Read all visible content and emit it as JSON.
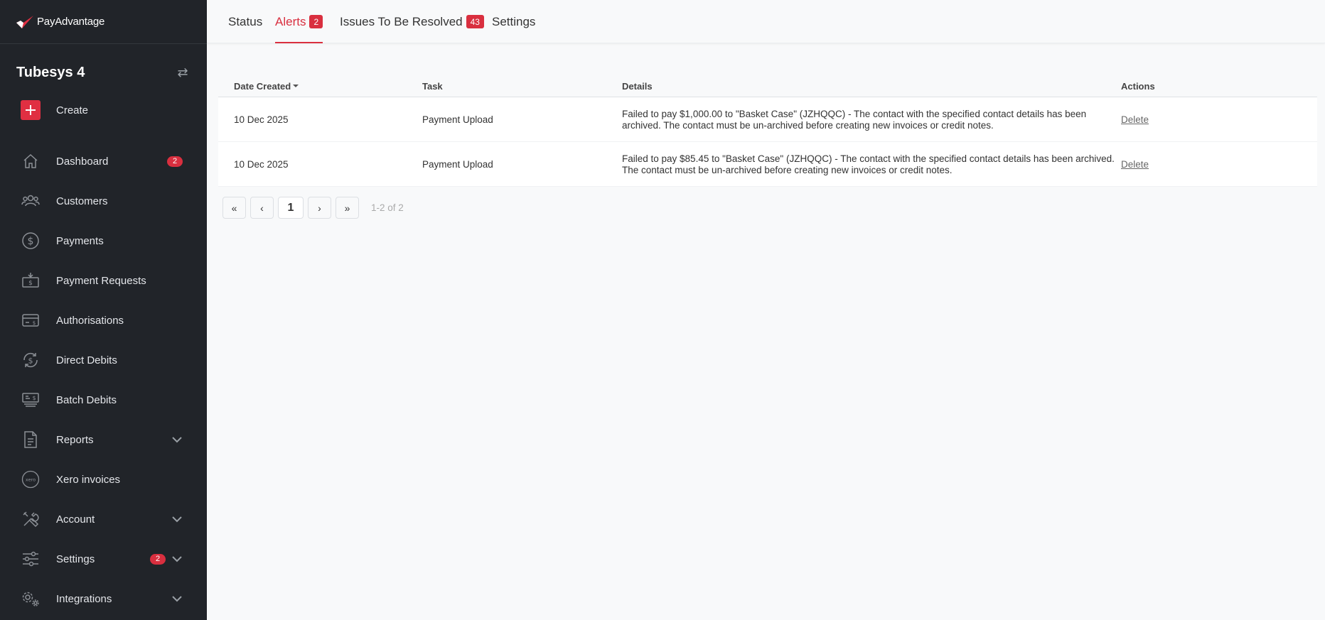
{
  "brand": {
    "name": "PayAdvantage"
  },
  "account": {
    "name": "Tubesys 4"
  },
  "sidebar": {
    "items": [
      {
        "label": "Create",
        "icon": "plus-icon"
      },
      {
        "label": "Dashboard",
        "icon": "home-icon",
        "badge": "2"
      },
      {
        "label": "Customers",
        "icon": "users-icon"
      },
      {
        "label": "Payments",
        "icon": "dollar-circle-icon"
      },
      {
        "label": "Payment Requests",
        "icon": "payment-request-icon"
      },
      {
        "label": "Authorisations",
        "icon": "card-icon"
      },
      {
        "label": "Direct Debits",
        "icon": "recurring-dollar-icon"
      },
      {
        "label": "Batch Debits",
        "icon": "batch-icon"
      },
      {
        "label": "Reports",
        "icon": "document-icon"
      },
      {
        "label": "Xero invoices",
        "icon": "xero-icon"
      },
      {
        "label": "Account",
        "icon": "tools-icon"
      },
      {
        "label": "Settings",
        "icon": "sliders-icon",
        "badge": "2"
      },
      {
        "label": "Integrations",
        "icon": "gears-icon"
      }
    ]
  },
  "tabs": [
    {
      "label": "Status"
    },
    {
      "label": "Alerts",
      "badge": "2"
    },
    {
      "label": "Issues To Be Resolved",
      "badge": "43"
    },
    {
      "label": "Settings"
    }
  ],
  "table": {
    "headers": {
      "date": "Date Created",
      "task": "Task",
      "details": "Details",
      "actions": "Actions"
    },
    "rows": [
      {
        "date": "10 Dec 2025",
        "task": "Payment Upload",
        "details": "Failed to pay $1,000.00 to \"Basket Case\" (JZHQQC) - The contact with the specified contact details has been archived. The contact must be un-archived before creating new invoices or credit notes.",
        "action": "Delete"
      },
      {
        "date": "10 Dec 2025",
        "task": "Payment Upload",
        "details": "Failed to pay $85.45 to \"Basket Case\" (JZHQQC) - The contact with the specified contact details has been archived. The contact must be un-archived before creating new invoices or credit notes.",
        "action": "Delete"
      }
    ]
  },
  "pagination": {
    "first": "«",
    "prev": "‹",
    "current": "1",
    "next": "›",
    "last": "»",
    "info": "1-2 of 2"
  },
  "colors": {
    "accent": "#d92f3f",
    "sidebar_bg": "#212429"
  }
}
